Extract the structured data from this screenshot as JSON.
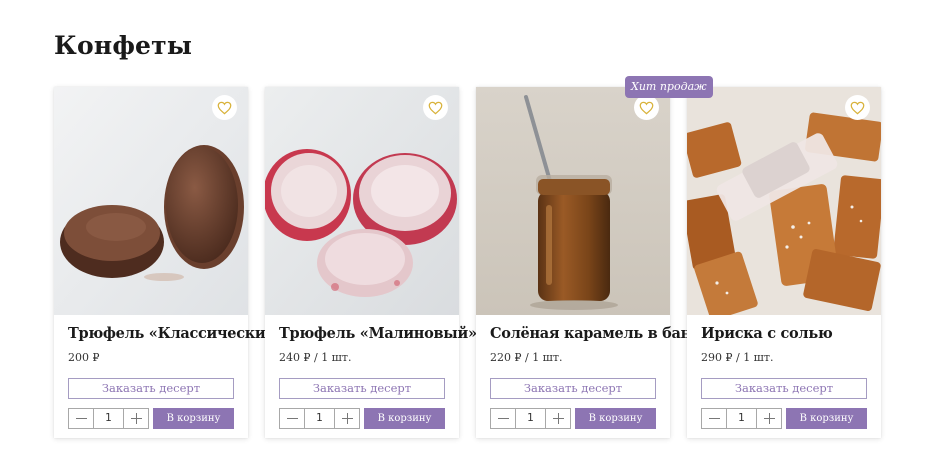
{
  "section": {
    "title": "Конфеты"
  },
  "badge_color": "#8d75b3",
  "products": [
    {
      "title": "Трюфель «Классический»",
      "price": "200 ₽",
      "badge": null,
      "order_label": "Заказать десерт",
      "quantity": "1",
      "cart_label": "В корзину",
      "favorite_icon": "heart-outline-icon"
    },
    {
      "title": "Трюфель «Малиновый»",
      "price": "240 ₽ / 1 шт.",
      "badge": null,
      "order_label": "Заказать десерт",
      "quantity": "1",
      "cart_label": "В корзину",
      "favorite_icon": "heart-outline-icon"
    },
    {
      "title": "Солёная карамель в банке",
      "price": "220 ₽ / 1 шт.",
      "badge": null,
      "order_label": "Заказать десерт",
      "quantity": "1",
      "cart_label": "В корзину",
      "favorite_icon": "heart-outline-icon"
    },
    {
      "title": "Ириска с солью",
      "price": "290 ₽ / 1 шт.",
      "badge": "Хит продаж",
      "order_label": "Заказать десерт",
      "quantity": "1",
      "cart_label": "В корзину",
      "favorite_icon": "heart-outline-icon"
    }
  ]
}
